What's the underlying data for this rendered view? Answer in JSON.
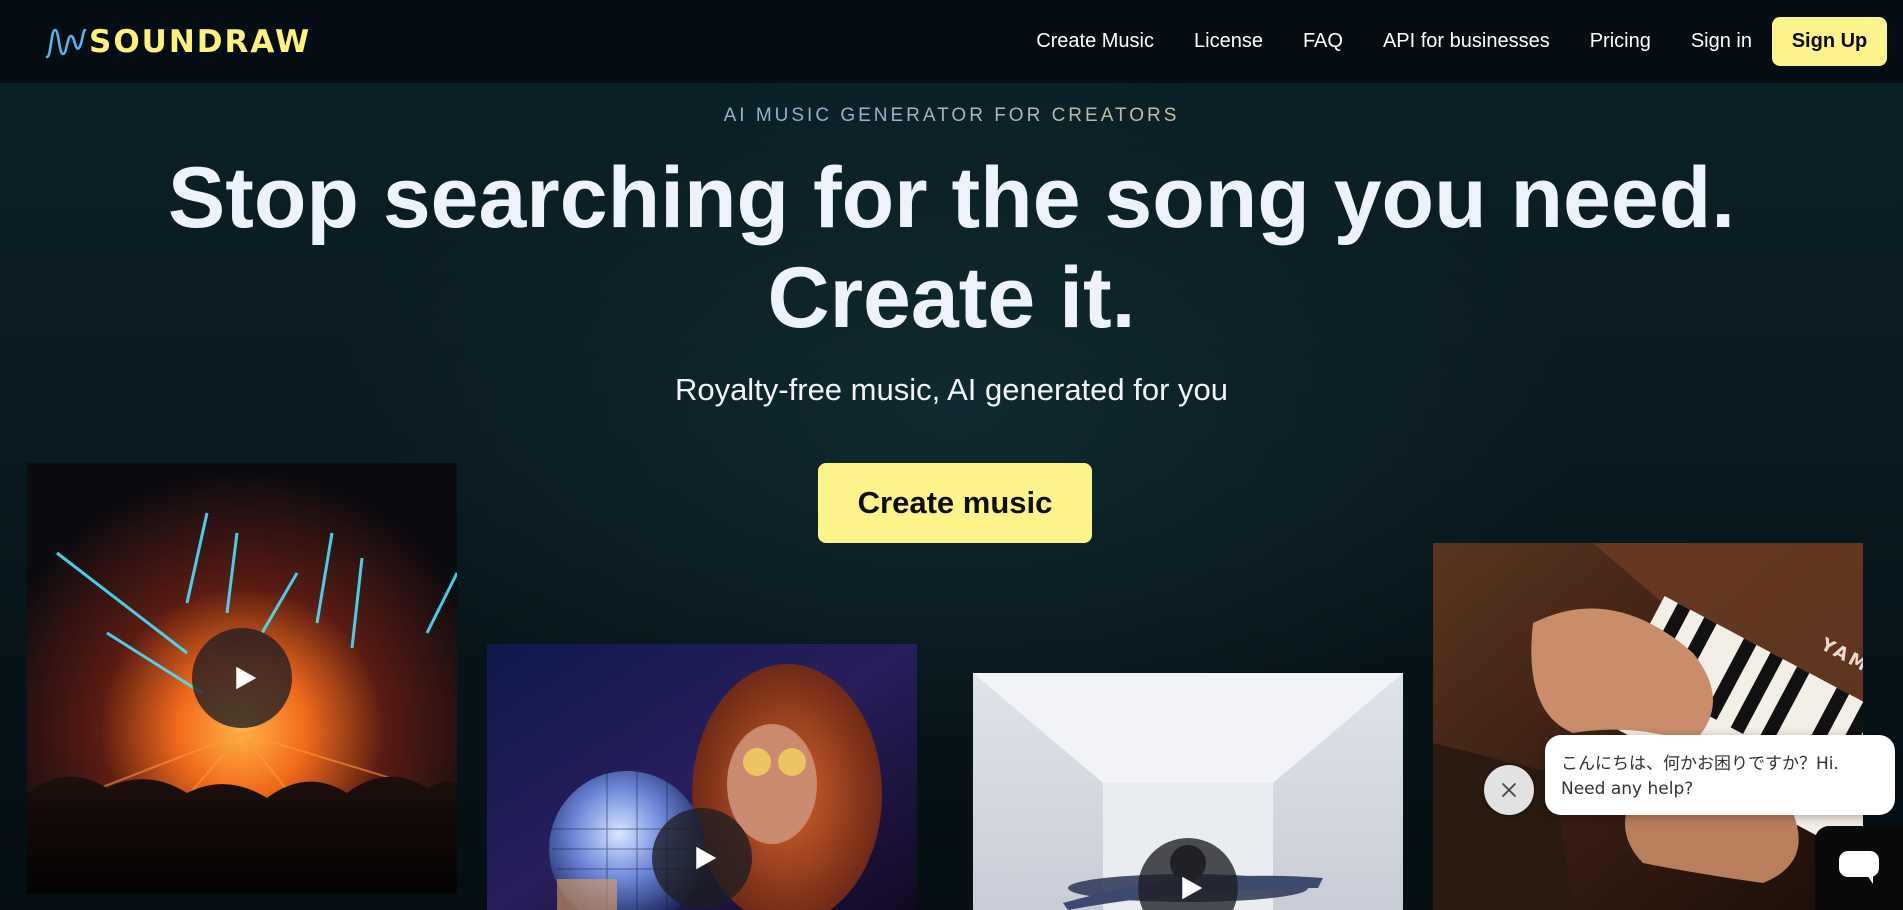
{
  "header": {
    "logo_text": "SOUNDRAW",
    "nav": [
      {
        "label": "Create Music"
      },
      {
        "label": "License"
      },
      {
        "label": "FAQ"
      },
      {
        "label": "API for businesses"
      },
      {
        "label": "Pricing"
      },
      {
        "label": "Sign in"
      }
    ],
    "signup_label": "Sign Up"
  },
  "hero": {
    "eyebrow": "AI MUSIC GENERATOR FOR CREATORS",
    "headline_line1": "Stop searching for the song you need.",
    "headline_line2": "Create it.",
    "subhead": "Royalty-free music, AI generated for you",
    "cta_label": "Create music"
  },
  "cards": [
    {
      "image": "concert-stage-lasers",
      "icon": "play-icon"
    },
    {
      "image": "woman-disco-ball",
      "icon": "play-icon"
    },
    {
      "image": "person-arms-spread-white-room",
      "icon": "play-icon"
    },
    {
      "image": "hands-playing-piano",
      "icon": "play-icon",
      "image_text": "YAM"
    }
  ],
  "chat": {
    "message_line1": "こんにちは、何かお困りですか？Hi.",
    "message_line2": "Need any help?",
    "close_icon": "close-icon",
    "launcher_icon": "chat-icon"
  },
  "colors": {
    "accent": "#fcf48a",
    "logo": "#fdf27e",
    "header_bg": "#050c12",
    "page_bg": "#0a1a1f",
    "headline": "#eef3fb"
  }
}
